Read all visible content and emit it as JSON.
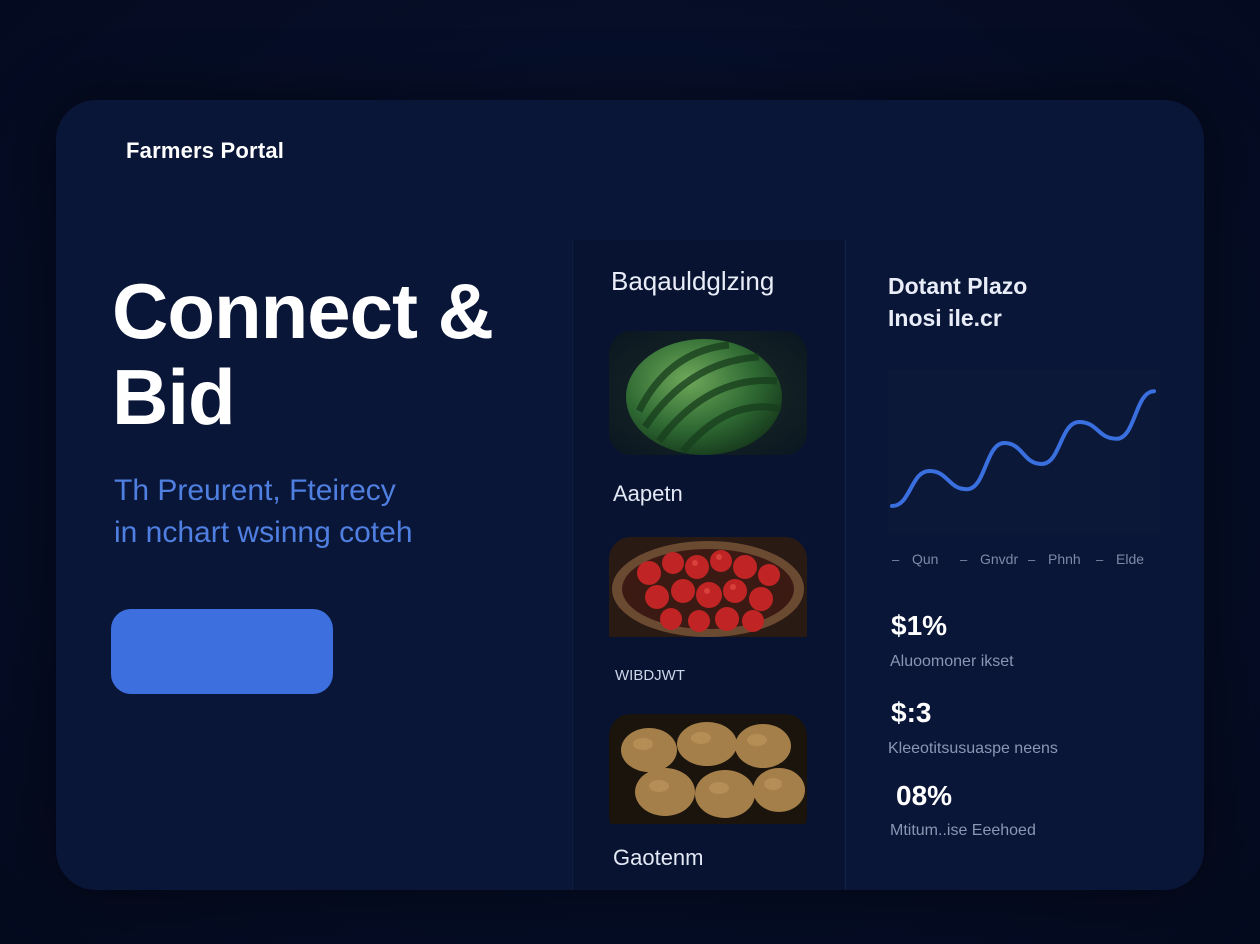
{
  "brand": {
    "name": "Farmers Portal"
  },
  "hero": {
    "headline_line1": "Connect &",
    "headline_line2": "Bid",
    "sub_line1": "Th Preurent, Fteirecy",
    "sub_line2": "in nchart wsinng coteh",
    "cta_label": ""
  },
  "produce": {
    "title": "Baqauldglzing",
    "items": [
      {
        "label": "Aapetn",
        "image": "watermelon"
      },
      {
        "label": "WIBDJWT",
        "image": "tomatoes"
      },
      {
        "label": "Gaotenm",
        "image": "potatoes"
      }
    ]
  },
  "stats": {
    "title_line1": "Dotant Plazo",
    "title_line2": "Inosi ile.cr",
    "chart_data": {
      "type": "line",
      "x": [
        "Qun",
        "Gnvdr",
        "Phnh",
        "Elde"
      ],
      "series": [
        {
          "values": [
            10,
            35,
            22,
            55,
            40,
            70,
            58,
            92
          ]
        }
      ],
      "ylim": [
        0,
        100
      ],
      "grid": false,
      "line_color": "#3a6fe0"
    },
    "items": [
      {
        "value": "$1%",
        "label": "Aluoomoner ikset"
      },
      {
        "value": "$:3",
        "label": "Kleeotitsusuaspe neens"
      },
      {
        "value": "08%",
        "label": "Mtitum..ise Eeehoed"
      }
    ]
  },
  "colors": {
    "background": "#050c22",
    "card": "#0a1637",
    "accent": "#3d6fdf",
    "subline": "#4f7fe0"
  }
}
